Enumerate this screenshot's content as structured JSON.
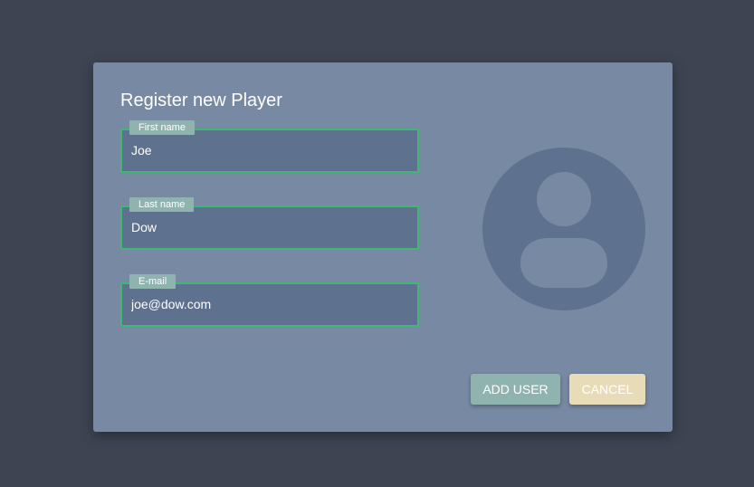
{
  "dialog": {
    "title": "Register new Player",
    "fields": [
      {
        "label": "First name",
        "value": "Joe"
      },
      {
        "label": "Last name",
        "value": "Dow"
      },
      {
        "label": "E-mail",
        "value": "joe@dow.com"
      }
    ],
    "avatar_icon": "user-avatar-icon",
    "buttons": {
      "add_label": "ADD USER",
      "cancel_label": "CANCEL"
    }
  },
  "colors": {
    "backdrop": "#3e4452",
    "dialog": "#7889a3",
    "input_bg": "#5e718f",
    "input_border": "#3fb876",
    "label_bg": "#8fb4b0",
    "add_button": "#8fb4b0",
    "cancel_button": "#e8dcb8"
  }
}
